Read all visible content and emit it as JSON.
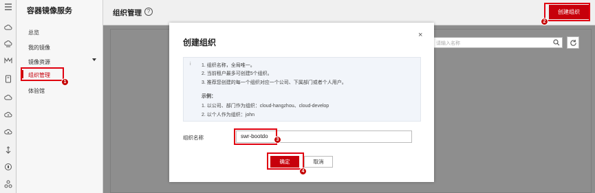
{
  "sidebar": {
    "title": "容器镜像服务",
    "items": [
      {
        "label": "总览"
      },
      {
        "label": "我的镜像"
      },
      {
        "label": "镜像资源"
      },
      {
        "label": "组织管理"
      },
      {
        "label": "体验馆"
      }
    ]
  },
  "header": {
    "page_title": "组织管理",
    "help_glyph": "?",
    "create_button": "创建组织"
  },
  "search": {
    "placeholder": "请输入名称"
  },
  "dialog": {
    "title": "创建组织",
    "close_glyph": "×",
    "info_icon": "i",
    "info_lines": [
      "1. 组织名称，全局唯一。",
      "2. 当前租户最多可创建5个组织。",
      "3. 推荐您创建的每一个组织对应一个公司、下属部门或者个人用户。"
    ],
    "example_title": "示例：",
    "example_lines": [
      "1. 以公司、部门作为组织：cloud-hangzhou、cloud-develop",
      "2. 以个人作为组织：john"
    ],
    "field_label": "组织名称",
    "field_value": "swr-bootdo",
    "ok_button": "确定",
    "cancel_button": "取消"
  },
  "annotations": {
    "step1": "1",
    "step2": "2",
    "step3": "3",
    "step4": "4",
    "color": "#e0000f"
  },
  "colors": {
    "accent": "#c7000b"
  }
}
